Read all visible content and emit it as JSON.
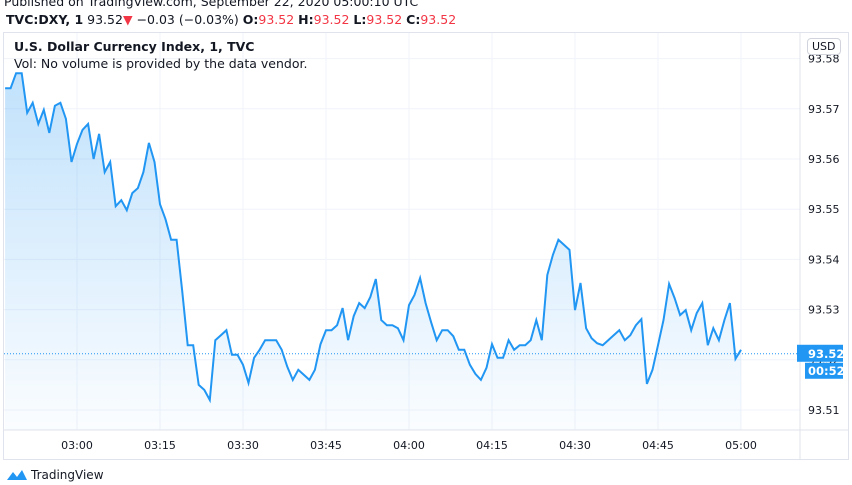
{
  "header": {
    "published": "Published on TradingView.com, September 22, 2020 05:00:10 UTC",
    "symbol": "TVC:DXY, 1",
    "last": "93.52",
    "change": "−0.03 (−0.03%)",
    "o_label": "O:",
    "o": "93.52",
    "h_label": "H:",
    "h": "93.52",
    "l_label": "L:",
    "l": "93.52",
    "c_label": "C:",
    "c": "93.52",
    "down_icon": "triangle-down-icon"
  },
  "legend": {
    "title": "U.S. Dollar Currency Index, 1, TVC",
    "volume_note": "Vol: No volume is provided by the data vendor."
  },
  "currency_button": "USD",
  "price_label": "93.52",
  "countdown_label": "00:52",
  "footer": {
    "brand": "TradingView"
  },
  "colors": {
    "line": "#2196f3",
    "price_tag": "#2196f3",
    "down": "#f23645",
    "grid": "#f0f3fa"
  },
  "chart_data": {
    "type": "area",
    "x_start": "02:47",
    "x_interval_minutes": 1,
    "xticks": [
      "03:00",
      "03:15",
      "03:30",
      "03:45",
      "04:00",
      "04:15",
      "04:30",
      "04:45",
      "05:00"
    ],
    "yticks": [
      "93.58",
      "93.57",
      "93.56",
      "93.55",
      "93.54",
      "93.53",
      "93.52",
      "93.51"
    ],
    "ylim": [
      93.507,
      93.583
    ],
    "grid": true,
    "current_price": 93.5212,
    "values": [
      93.5741,
      93.5741,
      93.5771,
      93.5771,
      93.5692,
      93.5712,
      93.567,
      93.5698,
      93.5652,
      93.5706,
      93.5712,
      93.568,
      93.5594,
      93.563,
      93.5658,
      93.567,
      93.56,
      93.565,
      93.5574,
      93.5594,
      93.5506,
      93.5518,
      93.5498,
      93.5532,
      93.5542,
      93.5574,
      93.5632,
      93.5594,
      93.551,
      93.548,
      93.5439,
      93.5439,
      93.5339,
      93.5229,
      93.5229,
      93.515,
      93.514,
      93.512,
      93.5239,
      93.5249,
      93.5259,
      93.521,
      93.521,
      93.519,
      93.5154,
      93.5204,
      93.522,
      93.5239,
      93.5239,
      93.5239,
      93.522,
      93.5186,
      93.516,
      93.518,
      93.517,
      93.516,
      93.518,
      93.5231,
      93.5259,
      93.5259,
      93.5269,
      93.5303,
      93.5239,
      93.5287,
      93.5313,
      93.5303,
      93.5325,
      93.5361,
      93.5279,
      93.5269,
      93.5269,
      93.5263,
      93.5239,
      93.5309,
      93.5329,
      93.5363,
      93.5313,
      93.5275,
      93.5239,
      93.5259,
      93.5259,
      93.5247,
      93.522,
      93.522,
      93.519,
      93.5172,
      93.516,
      93.5184,
      93.5231,
      93.5204,
      93.5204,
      93.5239,
      93.522,
      93.5229,
      93.5229,
      93.5239,
      93.5279,
      93.5239,
      93.5369,
      93.5409,
      93.5439,
      93.5429,
      93.5419,
      93.5299,
      93.5353,
      93.5263,
      93.5243,
      93.5233,
      93.5229,
      93.5239,
      93.5249,
      93.5259,
      93.5239,
      93.5249,
      93.5269,
      93.5281,
      93.5152,
      93.518,
      93.5229,
      93.5279,
      93.5351,
      93.5323,
      93.5289,
      93.5299,
      93.5259,
      93.5293,
      93.5313,
      93.5229,
      93.5263,
      93.5239,
      93.5279,
      93.5313,
      93.5202,
      93.522
    ]
  }
}
